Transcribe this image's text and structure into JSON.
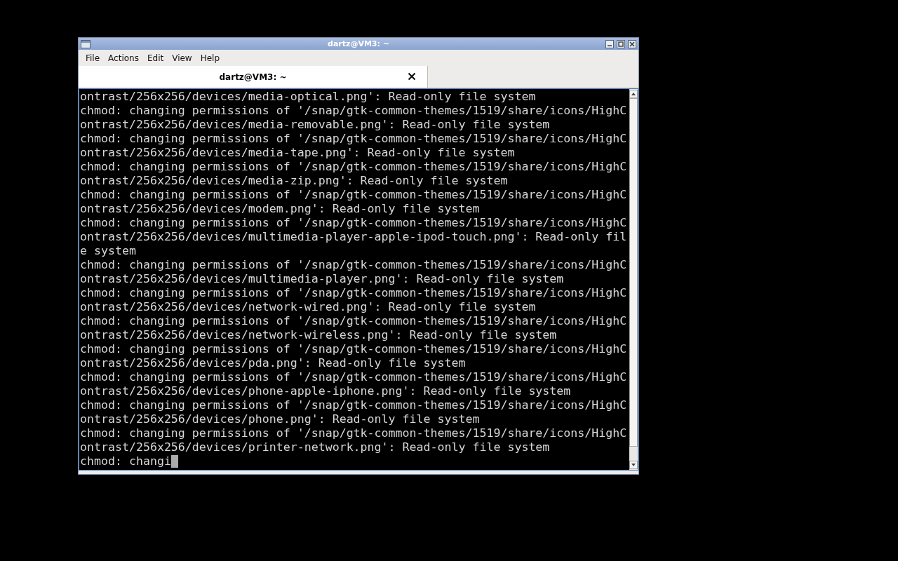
{
  "window": {
    "title": "dartz@VM3: ~"
  },
  "menu": [
    "File",
    "Actions",
    "Edit",
    "View",
    "Help"
  ],
  "tabs": [
    {
      "label": "dartz@VM3: ~",
      "selected": true
    }
  ],
  "terminal": {
    "lines": [
      "ontrast/256x256/devices/media-optical.png': Read-only file system",
      "chmod: changing permissions of '/snap/gtk-common-themes/1519/share/icons/HighC",
      "ontrast/256x256/devices/media-removable.png': Read-only file system",
      "chmod: changing permissions of '/snap/gtk-common-themes/1519/share/icons/HighC",
      "ontrast/256x256/devices/media-tape.png': Read-only file system",
      "chmod: changing permissions of '/snap/gtk-common-themes/1519/share/icons/HighC",
      "ontrast/256x256/devices/media-zip.png': Read-only file system",
      "chmod: changing permissions of '/snap/gtk-common-themes/1519/share/icons/HighC",
      "ontrast/256x256/devices/modem.png': Read-only file system",
      "chmod: changing permissions of '/snap/gtk-common-themes/1519/share/icons/HighC",
      "ontrast/256x256/devices/multimedia-player-apple-ipod-touch.png': Read-only fil",
      "e system",
      "chmod: changing permissions of '/snap/gtk-common-themes/1519/share/icons/HighC",
      "ontrast/256x256/devices/multimedia-player.png': Read-only file system",
      "chmod: changing permissions of '/snap/gtk-common-themes/1519/share/icons/HighC",
      "ontrast/256x256/devices/network-wired.png': Read-only file system",
      "chmod: changing permissions of '/snap/gtk-common-themes/1519/share/icons/HighC",
      "ontrast/256x256/devices/network-wireless.png': Read-only file system",
      "chmod: changing permissions of '/snap/gtk-common-themes/1519/share/icons/HighC",
      "ontrast/256x256/devices/pda.png': Read-only file system",
      "chmod: changing permissions of '/snap/gtk-common-themes/1519/share/icons/HighC",
      "ontrast/256x256/devices/phone-apple-iphone.png': Read-only file system",
      "chmod: changing permissions of '/snap/gtk-common-themes/1519/share/icons/HighC",
      "ontrast/256x256/devices/phone.png': Read-only file system",
      "chmod: changing permissions of '/snap/gtk-common-themes/1519/share/icons/HighC",
      "ontrast/256x256/devices/printer-network.png': Read-only file system",
      "chmod: changi"
    ]
  }
}
